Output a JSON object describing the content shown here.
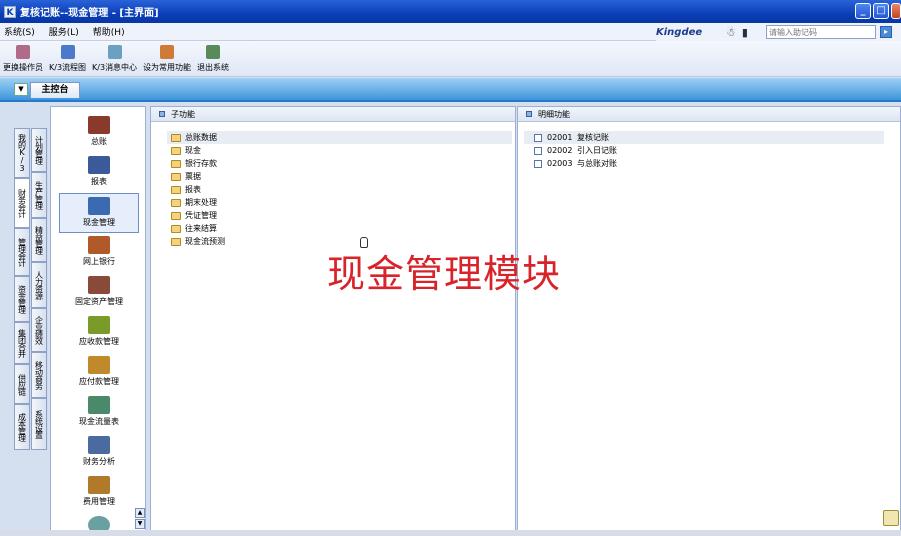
{
  "window": {
    "title": "复核记账--现金管理 - [主界面]",
    "icon_glyph": "K"
  },
  "menu": [
    "系统(S)",
    "服务(L)",
    "帮助(H)"
  ],
  "brand": {
    "name": "Kingdee",
    "search_placeholder": "请输入助记码"
  },
  "toolbar": [
    {
      "label": "更换操作员",
      "color": "#b06a8a"
    },
    {
      "label": "K/3流程图",
      "color": "#4a7acb"
    },
    {
      "label": "K/3消息中心",
      "color": "#6aa0c0"
    },
    {
      "label": "设为常用功能",
      "color": "#d07a3a"
    },
    {
      "label": "退出系统",
      "color": "#5a8a5a"
    }
  ],
  "main_tab": "主控台",
  "left_nav": {
    "outer": [
      "我的K/3",
      "财务会计",
      "管理会计",
      "资金管理",
      "集团合并",
      "供应链",
      "成本管理"
    ],
    "inner": [
      "计划管理",
      "生产管理",
      "精益管理",
      "人力资源",
      "企业绩效",
      "移动商务",
      "系统设置"
    ]
  },
  "modules": [
    {
      "label": "总账",
      "color": "#8a3a2a"
    },
    {
      "label": "报表",
      "color": "#3a5a9a"
    },
    {
      "label": "现金管理",
      "color": "#3a6ab0"
    },
    {
      "label": "网上银行",
      "color": "#b05a2a"
    },
    {
      "label": "固定资产管理",
      "color": "#8a4a3a"
    },
    {
      "label": "应收款管理",
      "color": "#7a9a2a"
    },
    {
      "label": "应付款管理",
      "color": "#c08a2a"
    },
    {
      "label": "现金流量表",
      "color": "#4a8a6a"
    },
    {
      "label": "财务分析",
      "color": "#4a6aa0"
    },
    {
      "label": "费用管理",
      "color": "#b07a2a"
    }
  ],
  "sub_panel": {
    "title": "子功能",
    "root": "总账数据",
    "items": [
      "现金",
      "银行存款",
      "票据",
      "报表",
      "期末处理",
      "凭证管理",
      "往来结算",
      "现金流预测"
    ]
  },
  "detail_panel": {
    "title": "明细功能",
    "items": [
      {
        "code": "02001",
        "label": "复核记账"
      },
      {
        "code": "02002",
        "label": "引入日记账"
      },
      {
        "code": "02003",
        "label": "与总账对账"
      }
    ]
  },
  "overlay_text": "现金管理模块"
}
